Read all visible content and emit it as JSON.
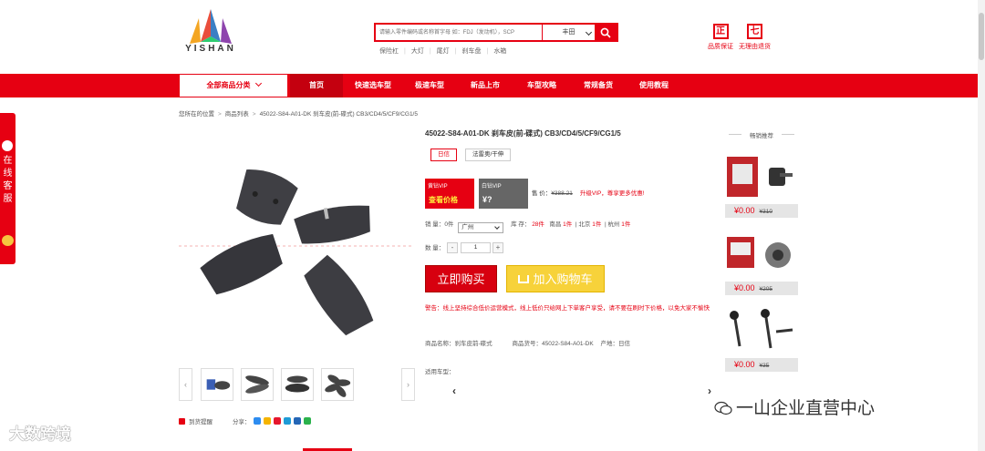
{
  "colors": {
    "accent": "#e60012",
    "nav_active": "#c4000f",
    "cart": "#f7d23a"
  },
  "header": {
    "logo_text": "YISHAN",
    "search": {
      "placeholder": "请输入零件编码或名称首字母 如：FDJ（发动机），SCP",
      "select_value": "丰田"
    },
    "hot_words": [
      "保险杠",
      "大灯",
      "尾灯",
      "刹车盘",
      "水箱"
    ],
    "badges": [
      {
        "icon": "正",
        "label": "品质保证"
      },
      {
        "icon": "七",
        "label": "无理由退货"
      }
    ]
  },
  "nav": {
    "category_label": "全部商品分类",
    "items": [
      "首页",
      "快速选车型",
      "极速车型",
      "新品上市",
      "车型攻略",
      "常规备货",
      "使用教程"
    ],
    "active_index": 0
  },
  "breadcrumb": [
    "您所在的位置",
    "商品列表",
    "45022-S84-A01-DK 刹车皮(前-碟式) CB3/CD4/5/CF9/CG1/5"
  ],
  "float_service": {
    "label": "在线客服"
  },
  "product": {
    "title": "45022-S84-A01-DK 刹车皮(前-碟式) CB3/CD4/5/CF9/CG1/5",
    "tags": [
      "日信",
      "法雷奥/干伸"
    ],
    "selected_tag_index": 0,
    "vip_gold": {
      "label": "黄钻VIP",
      "value": "查看价格"
    },
    "vip_white": {
      "label": "白钻VIP",
      "value": "¥?"
    },
    "price_label": "售 价：",
    "price": "¥388.21",
    "promo": "升级VIP，尊享更多优惠!",
    "sales_label": "销 量：",
    "sales": "0件",
    "warehouse": "广州",
    "stock_label": "库 存：",
    "stock": "28件",
    "other_stock": [
      {
        "city": "南昌",
        "qty": "1件"
      },
      {
        "city": "北京",
        "qty": "1件"
      },
      {
        "city": "杭州",
        "qty": "1件"
      }
    ],
    "qty_label": "数 量：",
    "qty": "1",
    "buy_label": "立即购买",
    "cart_label": "加入购物车",
    "warning": "警告：线上坚持综合低价运营模式，线上低价只给网上下单客户享受，请不要在刷时下价格，以免大家不愉快",
    "meta": [
      {
        "k": "商品名称：",
        "v": "刹车皮前-碟式"
      },
      {
        "k": "商品货号：",
        "v": "45022-S84-A01-DK"
      },
      {
        "k": "产地：",
        "v": "日信"
      }
    ],
    "applicable_label": "适用车型：",
    "collect_label": "到货提醒",
    "share_label": "分享："
  },
  "recommend": {
    "title": "畅销推荐",
    "items": [
      {
        "price": "¥0.00",
        "old": "¥310",
        "img": "brake-caliper"
      },
      {
        "price": "¥0.00",
        "old": "¥205",
        "img": "wheel-hub"
      },
      {
        "price": "¥0.00",
        "old": "¥35",
        "img": "stabilizer-link"
      }
    ]
  },
  "watermarks": {
    "left": "大数跨境",
    "right": "一山企业直营中心"
  }
}
